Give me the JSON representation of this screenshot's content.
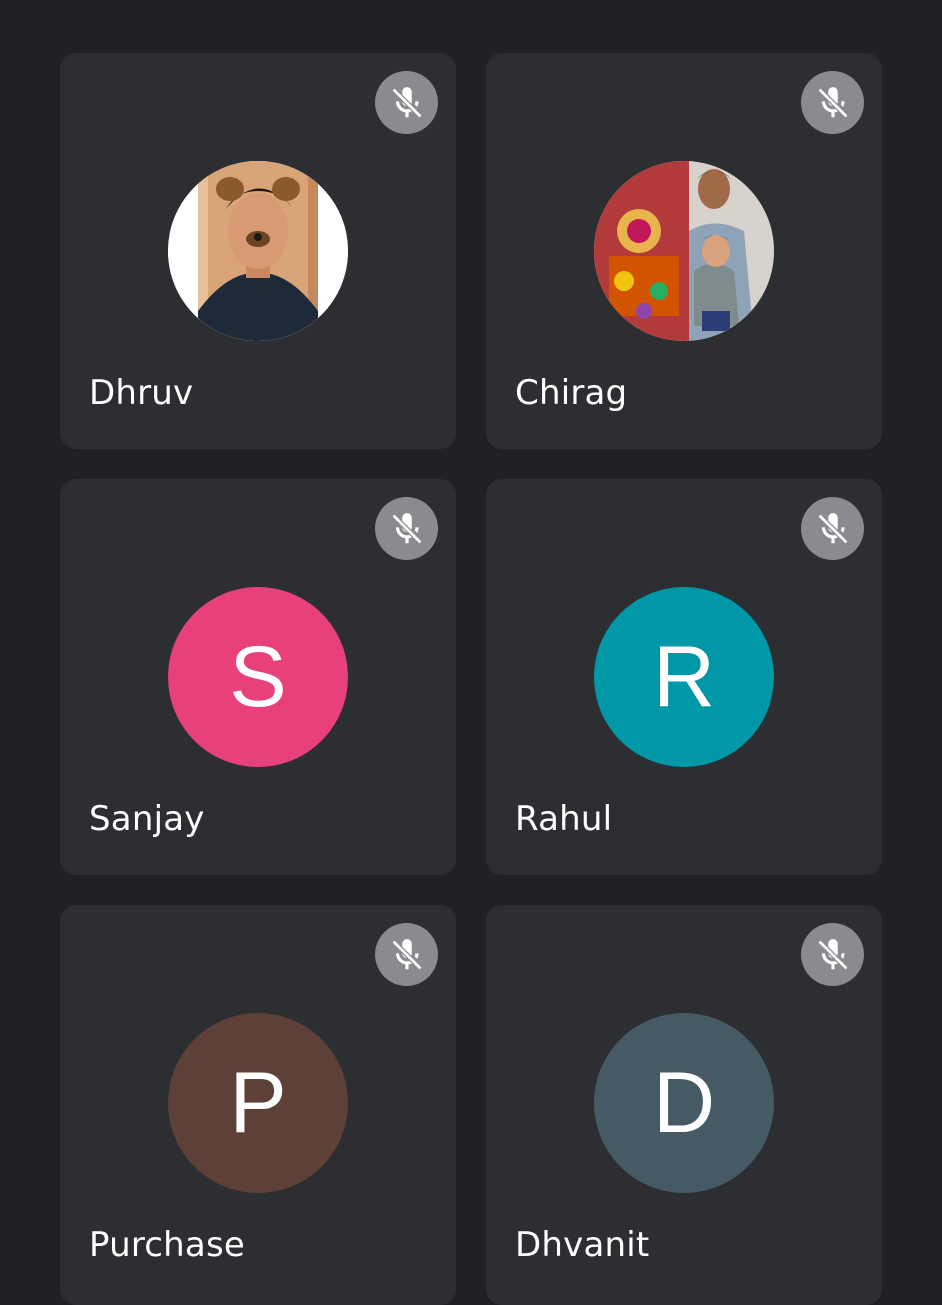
{
  "participants": [
    {
      "name": "Dhruv",
      "avatar_type": "photo",
      "photo_icon": "profile-photo-icon",
      "muted": true
    },
    {
      "name": "Chirag",
      "avatar_type": "photo",
      "photo_icon": "profile-photo-icon",
      "muted": true
    },
    {
      "name": "Sanjay",
      "avatar_type": "initial",
      "initial": "S",
      "color": "#e8407a",
      "muted": true
    },
    {
      "name": "Rahul",
      "avatar_type": "initial",
      "initial": "R",
      "color": "#0097a7",
      "muted": true
    },
    {
      "name": "Purchase",
      "avatar_type": "initial",
      "initial": "P",
      "color": "#5d4037",
      "muted": true
    },
    {
      "name": "Dhvanit",
      "avatar_type": "initial",
      "initial": "D",
      "color": "#455a64",
      "muted": true
    }
  ],
  "icons": {
    "mute": "mic-off-icon"
  },
  "colors": {
    "background": "#202124",
    "tile": "#2d2e31",
    "mute_badge": "#8a8b8e"
  }
}
